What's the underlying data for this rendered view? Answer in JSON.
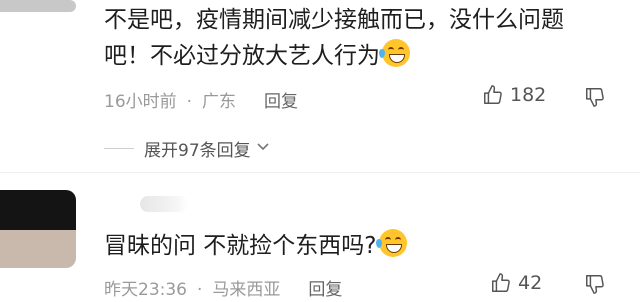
{
  "comments": [
    {
      "text": "不是吧，疫情期间减少接触而已，没什么问题吧！不必过分放大艺人行为",
      "emoji": "laughing-tears-emoji",
      "time": "16小时前",
      "location": "广东",
      "reply_label": "回复",
      "likes": "182",
      "expand_label": "展开97条回复"
    },
    {
      "text": "冒昧的问 不就捡个东西吗?",
      "emoji": "laughing-tears-emoji",
      "time": "昨天23:36",
      "location": "马来西亚",
      "reply_label": "回复",
      "likes": "42"
    }
  ],
  "separator_dot": "·"
}
